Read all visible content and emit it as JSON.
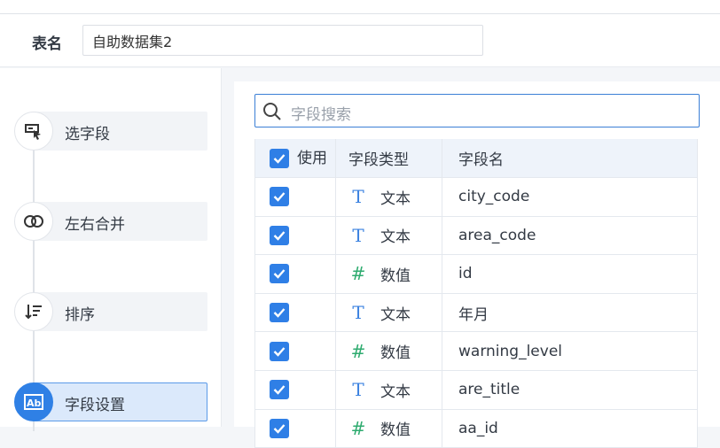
{
  "header": {
    "label": "表名",
    "table_name": "自助数据集2"
  },
  "steps": [
    {
      "label": "选字段",
      "icon": "select-field-icon"
    },
    {
      "label": "左右合并",
      "icon": "merge-icon"
    },
    {
      "label": "排序",
      "icon": "sort-icon"
    },
    {
      "label": "字段设置",
      "icon": "field-settings-icon",
      "active": true
    }
  ],
  "search": {
    "placeholder": "字段搜索"
  },
  "table": {
    "headers": {
      "use": "使用",
      "type": "字段类型",
      "name": "字段名"
    },
    "rows": [
      {
        "checked": true,
        "type": "文本",
        "type_icon": "T",
        "name": "city_code"
      },
      {
        "checked": true,
        "type": "文本",
        "type_icon": "T",
        "name": "area_code"
      },
      {
        "checked": true,
        "type": "数值",
        "type_icon": "#",
        "name": "id"
      },
      {
        "checked": true,
        "type": "文本",
        "type_icon": "T",
        "name": "年月"
      },
      {
        "checked": true,
        "type": "数值",
        "type_icon": "#",
        "name": "warning_level"
      },
      {
        "checked": true,
        "type": "文本",
        "type_icon": "T",
        "name": "are_title"
      },
      {
        "checked": true,
        "type": "数值",
        "type_icon": "#",
        "name": "aa_id"
      }
    ]
  },
  "colors": {
    "accent": "#2f7fe6",
    "number_icon": "#2eab6f",
    "text_icon": "#3b82e0"
  }
}
